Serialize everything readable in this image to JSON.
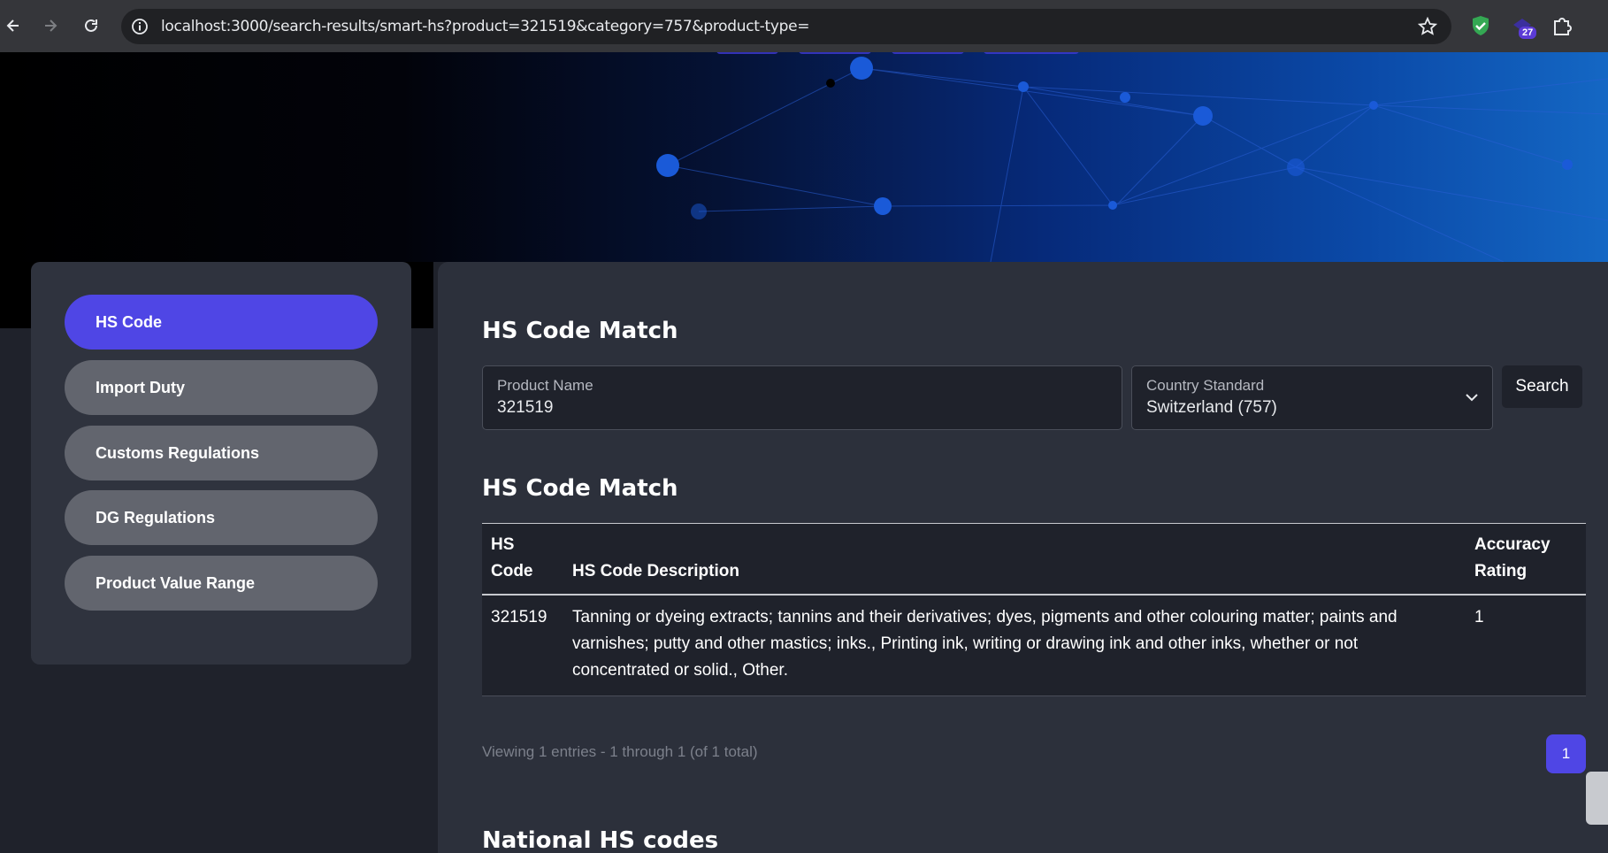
{
  "browser": {
    "url": "localhost:3000/search-results/smart-hs?product=321519&category=757&product-type=",
    "extension_badge": "27",
    "icons": [
      "back-icon",
      "forward-icon",
      "reload-icon",
      "info-icon",
      "star-icon",
      "shield-icon",
      "extension-profile-icon",
      "puzzle-icon"
    ]
  },
  "sidebar": {
    "items": [
      {
        "label": "HS Code",
        "active": true
      },
      {
        "label": "Import Duty",
        "active": false
      },
      {
        "label": "Customs Regulations",
        "active": false
      },
      {
        "label": "DG Regulations",
        "active": false
      },
      {
        "label": "Product Value Range",
        "active": false
      }
    ]
  },
  "main": {
    "search_title": "HS Code Match",
    "product_name": {
      "label": "Product Name",
      "value": "321519"
    },
    "country_standard": {
      "label": "Country Standard",
      "value": "Switzerland (757)"
    },
    "search_label": "Search",
    "results_title": "HS Code Match",
    "table": {
      "headers": [
        "HS Code",
        "HS Code Description",
        "Accuracy Rating"
      ],
      "rows": [
        {
          "code": "321519",
          "description_lines": [
            "Tanning or dyeing extracts; tannins and their derivatives; dyes, pigments and other colouring matter; paints and",
            "varnishes; putty and other mastics; inks., Printing ink, writing or drawing ink and other inks, whether or not",
            "concentrated or solid., Other."
          ],
          "accuracy": "1"
        }
      ]
    },
    "viewing_text": "Viewing 1 entries - 1 through 1 (of 1 total)",
    "current_page": "1",
    "national_title": "National HS codes"
  },
  "colors": {
    "accent": "#4f46e5",
    "panel": "#2c303b",
    "sidebar": "#2f333e",
    "inactive_item": "#62656e"
  }
}
